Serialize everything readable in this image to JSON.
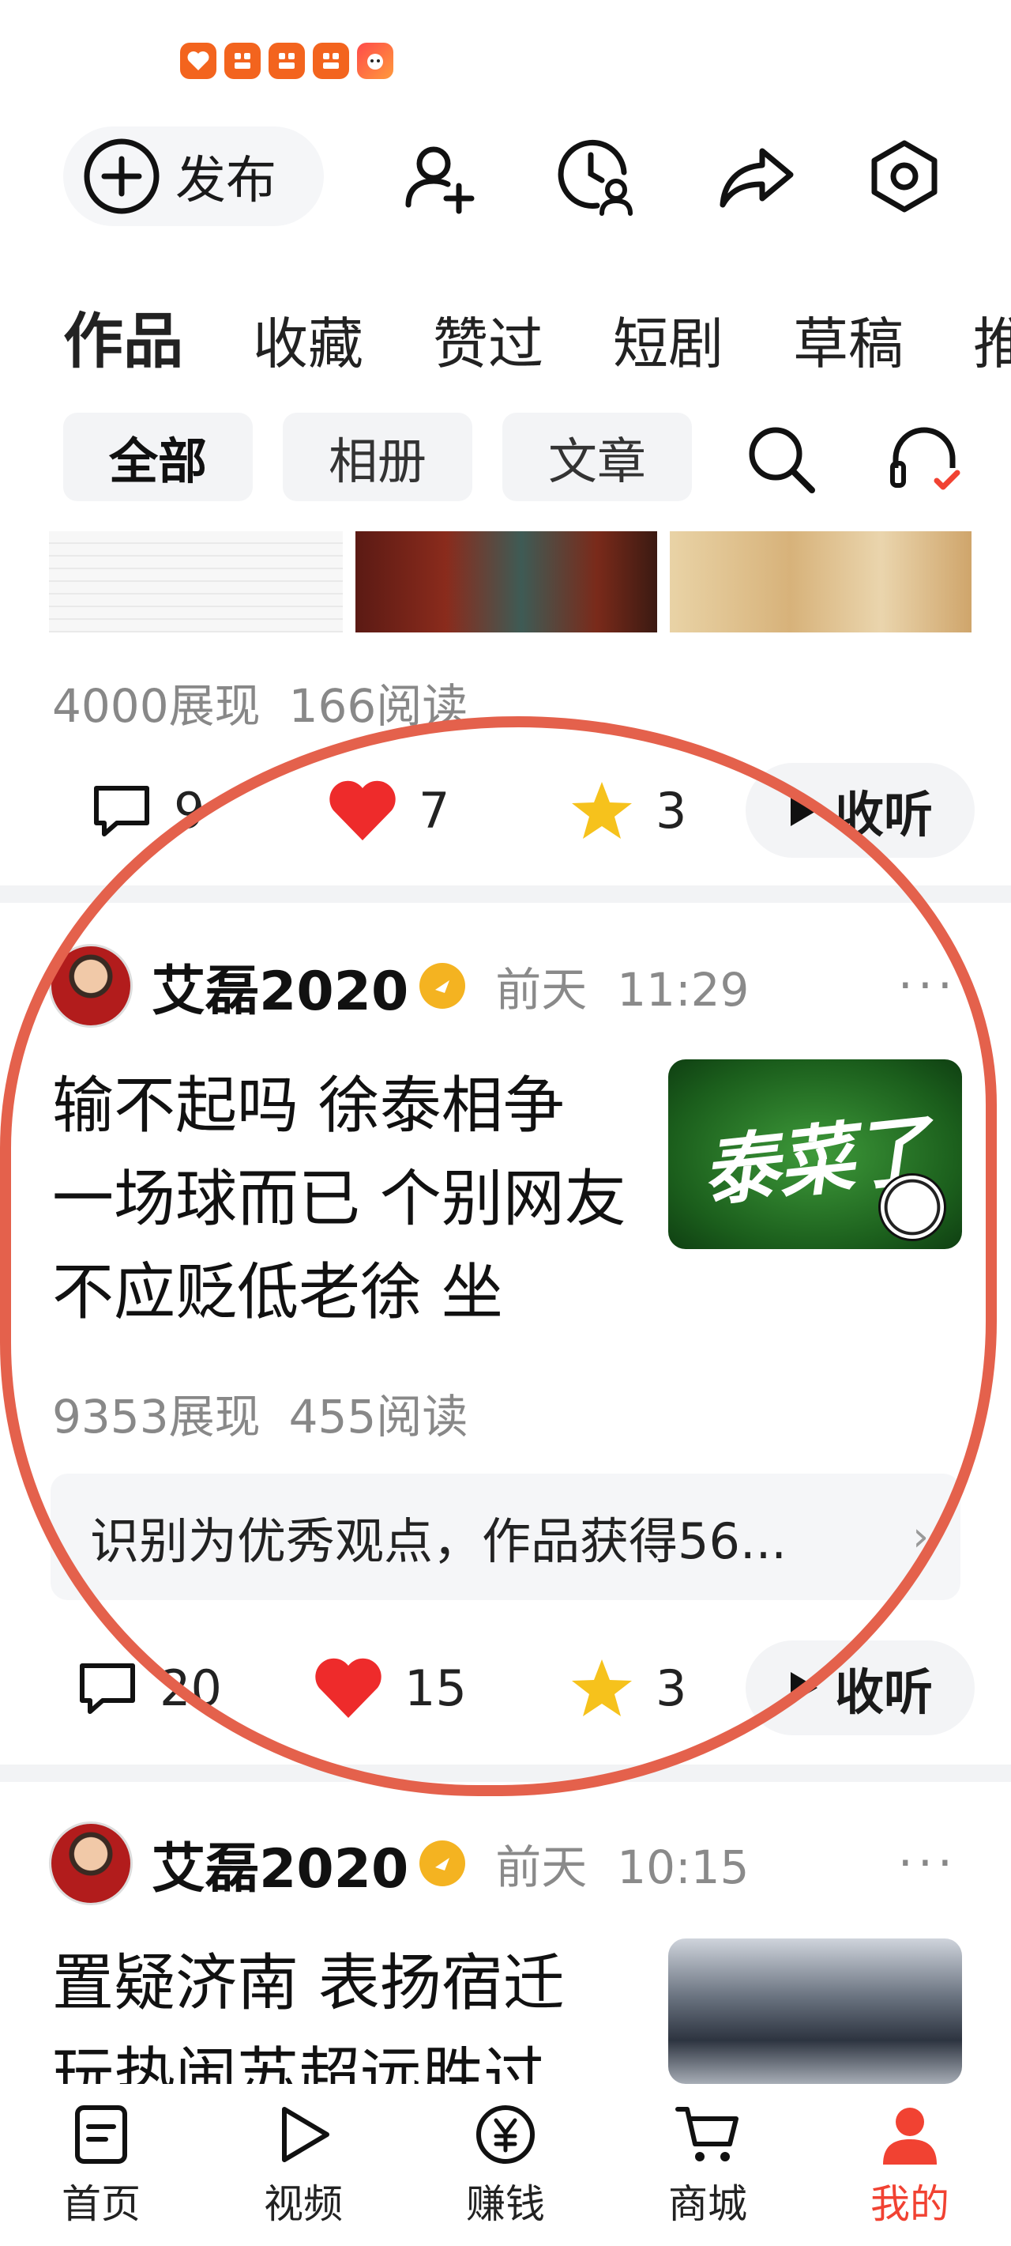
{
  "colors": {
    "accent": "#f14232",
    "annotation": "#e4614c",
    "heart": "#ee2b2b",
    "star": "#f6c21c",
    "verify": "#f4b321"
  },
  "header": {
    "status_icons": [
      "heart-app-icon",
      "app-icon",
      "app-icon",
      "app-icon",
      "mascot-app-icon"
    ],
    "publish_label": "发布",
    "icons": [
      "add-friend-icon",
      "history-icon",
      "share-icon",
      "settings-icon"
    ]
  },
  "tabs": [
    "作品",
    "收藏",
    "赞过",
    "短剧",
    "草稿",
    "推"
  ],
  "chips": [
    "全部",
    "相册",
    "文章"
  ],
  "prev_post": {
    "impressions": "4000展现",
    "reads": "166阅读",
    "comments": "9",
    "likes": "7",
    "favorites": "3",
    "listen": "收听"
  },
  "post1": {
    "author": "艾磊2020",
    "day": "前天",
    "time": "11:29",
    "more": "···",
    "title": "输不起吗 徐泰相争 一场球而已 个别网友不应贬低老徐 坐",
    "cover_text": "泰菜了",
    "impressions": "9353展现",
    "reads": "455阅读",
    "notice": "识别为优秀观点，作品获得56...",
    "comments": "20",
    "likes": "15",
    "favorites": "3",
    "listen": "收听"
  },
  "post2": {
    "author": "艾磊2020",
    "day": "前天",
    "time": "10:15",
    "more": "···",
    "title": "置疑济南 表扬宿迁 玩热闹苏超远胜过"
  },
  "bottom_nav": [
    {
      "label": "首页",
      "icon": "home-icon"
    },
    {
      "label": "视频",
      "icon": "video-play-icon"
    },
    {
      "label": "赚钱",
      "icon": "yuan-coin-icon"
    },
    {
      "label": "商城",
      "icon": "cart-icon"
    },
    {
      "label": "我的",
      "icon": "profile-icon"
    }
  ]
}
